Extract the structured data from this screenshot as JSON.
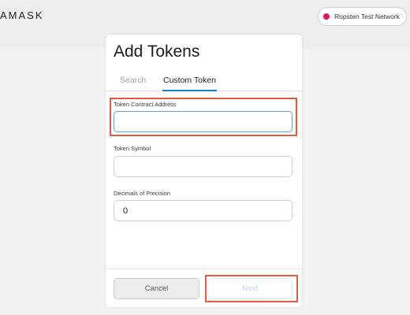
{
  "app": {
    "logo_text": "AMASK",
    "network_label": "Ropsten Test Network",
    "network_color": "#e91550"
  },
  "dialog": {
    "title": "Add Tokens",
    "tabs": [
      {
        "label": "Search",
        "active": false
      },
      {
        "label": "Custom Token",
        "active": true
      }
    ],
    "fields": {
      "contract_address": {
        "label": "Token Contract Address",
        "value": ""
      },
      "symbol": {
        "label": "Token Symbol",
        "value": ""
      },
      "decimals": {
        "label": "Decimals of Precision",
        "value": "0"
      }
    },
    "buttons": {
      "cancel_label": "Cancel",
      "next_label": "Next"
    }
  },
  "colors": {
    "accent": "#1f7ad0",
    "highlight": "#e05a3f"
  }
}
